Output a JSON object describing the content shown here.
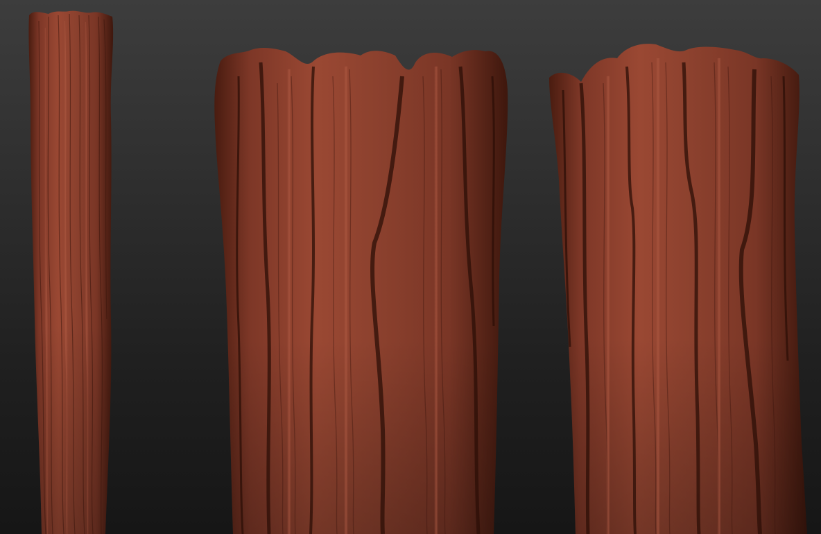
{
  "viewport": {
    "background_top": "#3d3d3d",
    "background_bottom": "#161616"
  },
  "material": {
    "base_color": "#8a3f2c",
    "highlight_color": "#a85540",
    "shadow_color": "#3a150c"
  },
  "models": [
    {
      "id": "trunk-thin"
    },
    {
      "id": "trunk-medium"
    },
    {
      "id": "trunk-wide"
    }
  ]
}
